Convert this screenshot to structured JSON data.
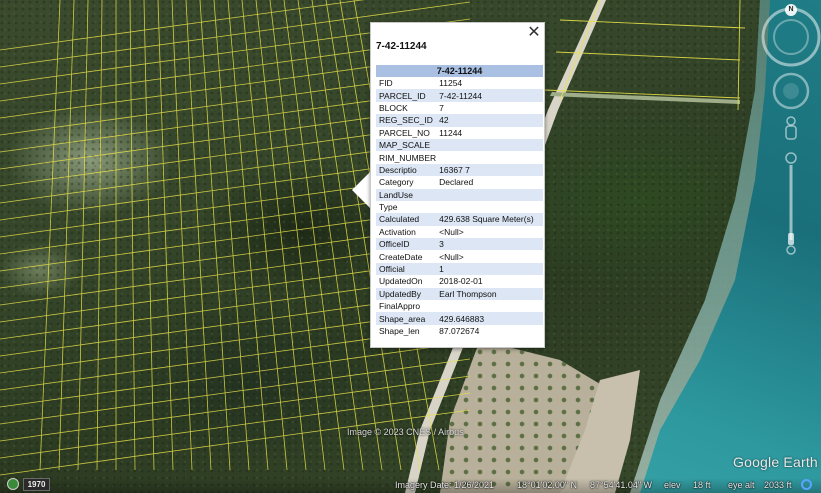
{
  "popup": {
    "title": "7-42-11244",
    "header": "7-42-11244",
    "rows": [
      {
        "key": "FID",
        "value": "11254"
      },
      {
        "key": "PARCEL_ID",
        "value": "7-42-11244"
      },
      {
        "key": "BLOCK",
        "value": "7"
      },
      {
        "key": "REG_SEC_ID",
        "value": "42"
      },
      {
        "key": "PARCEL_NO",
        "value": "11244"
      },
      {
        "key": "MAP_SCALE",
        "value": ""
      },
      {
        "key": "RIM_NUMBER",
        "value": ""
      },
      {
        "key": "Descriptio",
        "value": "16367 7"
      },
      {
        "key": "Category",
        "value": "Declared"
      },
      {
        "key": "LandUse",
        "value": ""
      },
      {
        "key": "Type",
        "value": ""
      },
      {
        "key": "Calculated",
        "value": "429.638 Square Meter(s)"
      },
      {
        "key": "Activation",
        "value": "<Null>"
      },
      {
        "key": "OfficeID",
        "value": "3"
      },
      {
        "key": "CreateDate",
        "value": "<Null>"
      },
      {
        "key": "Official",
        "value": "1"
      },
      {
        "key": "UpdatedOn",
        "value": "2018-02-01"
      },
      {
        "key": "UpdatedBy",
        "value": "Earl Thompson"
      },
      {
        "key": "FinalAppro",
        "value": ""
      },
      {
        "key": "Shape_area",
        "value": "429.646883"
      },
      {
        "key": "Shape_len",
        "value": "87.072674"
      }
    ]
  },
  "map": {
    "copyright": "Image © 2023 CNES / Airbus",
    "brand": "Google Earth",
    "compass_label": "N"
  },
  "status": {
    "history_year": "1970",
    "imagery_date": "Imagery Date: 1/26/2021",
    "latitude": "18°01'02.00\" N",
    "longitude": "87°54'41.04\" W",
    "elev_label": "elev",
    "elev_value": "18 ft",
    "eye_alt_label": "eye alt",
    "eye_alt_value": "2033 ft"
  },
  "colors": {
    "parcel_line": "#e8e24a",
    "table_header": "#a9c0e2",
    "table_row_alt": "#dce6f4"
  }
}
